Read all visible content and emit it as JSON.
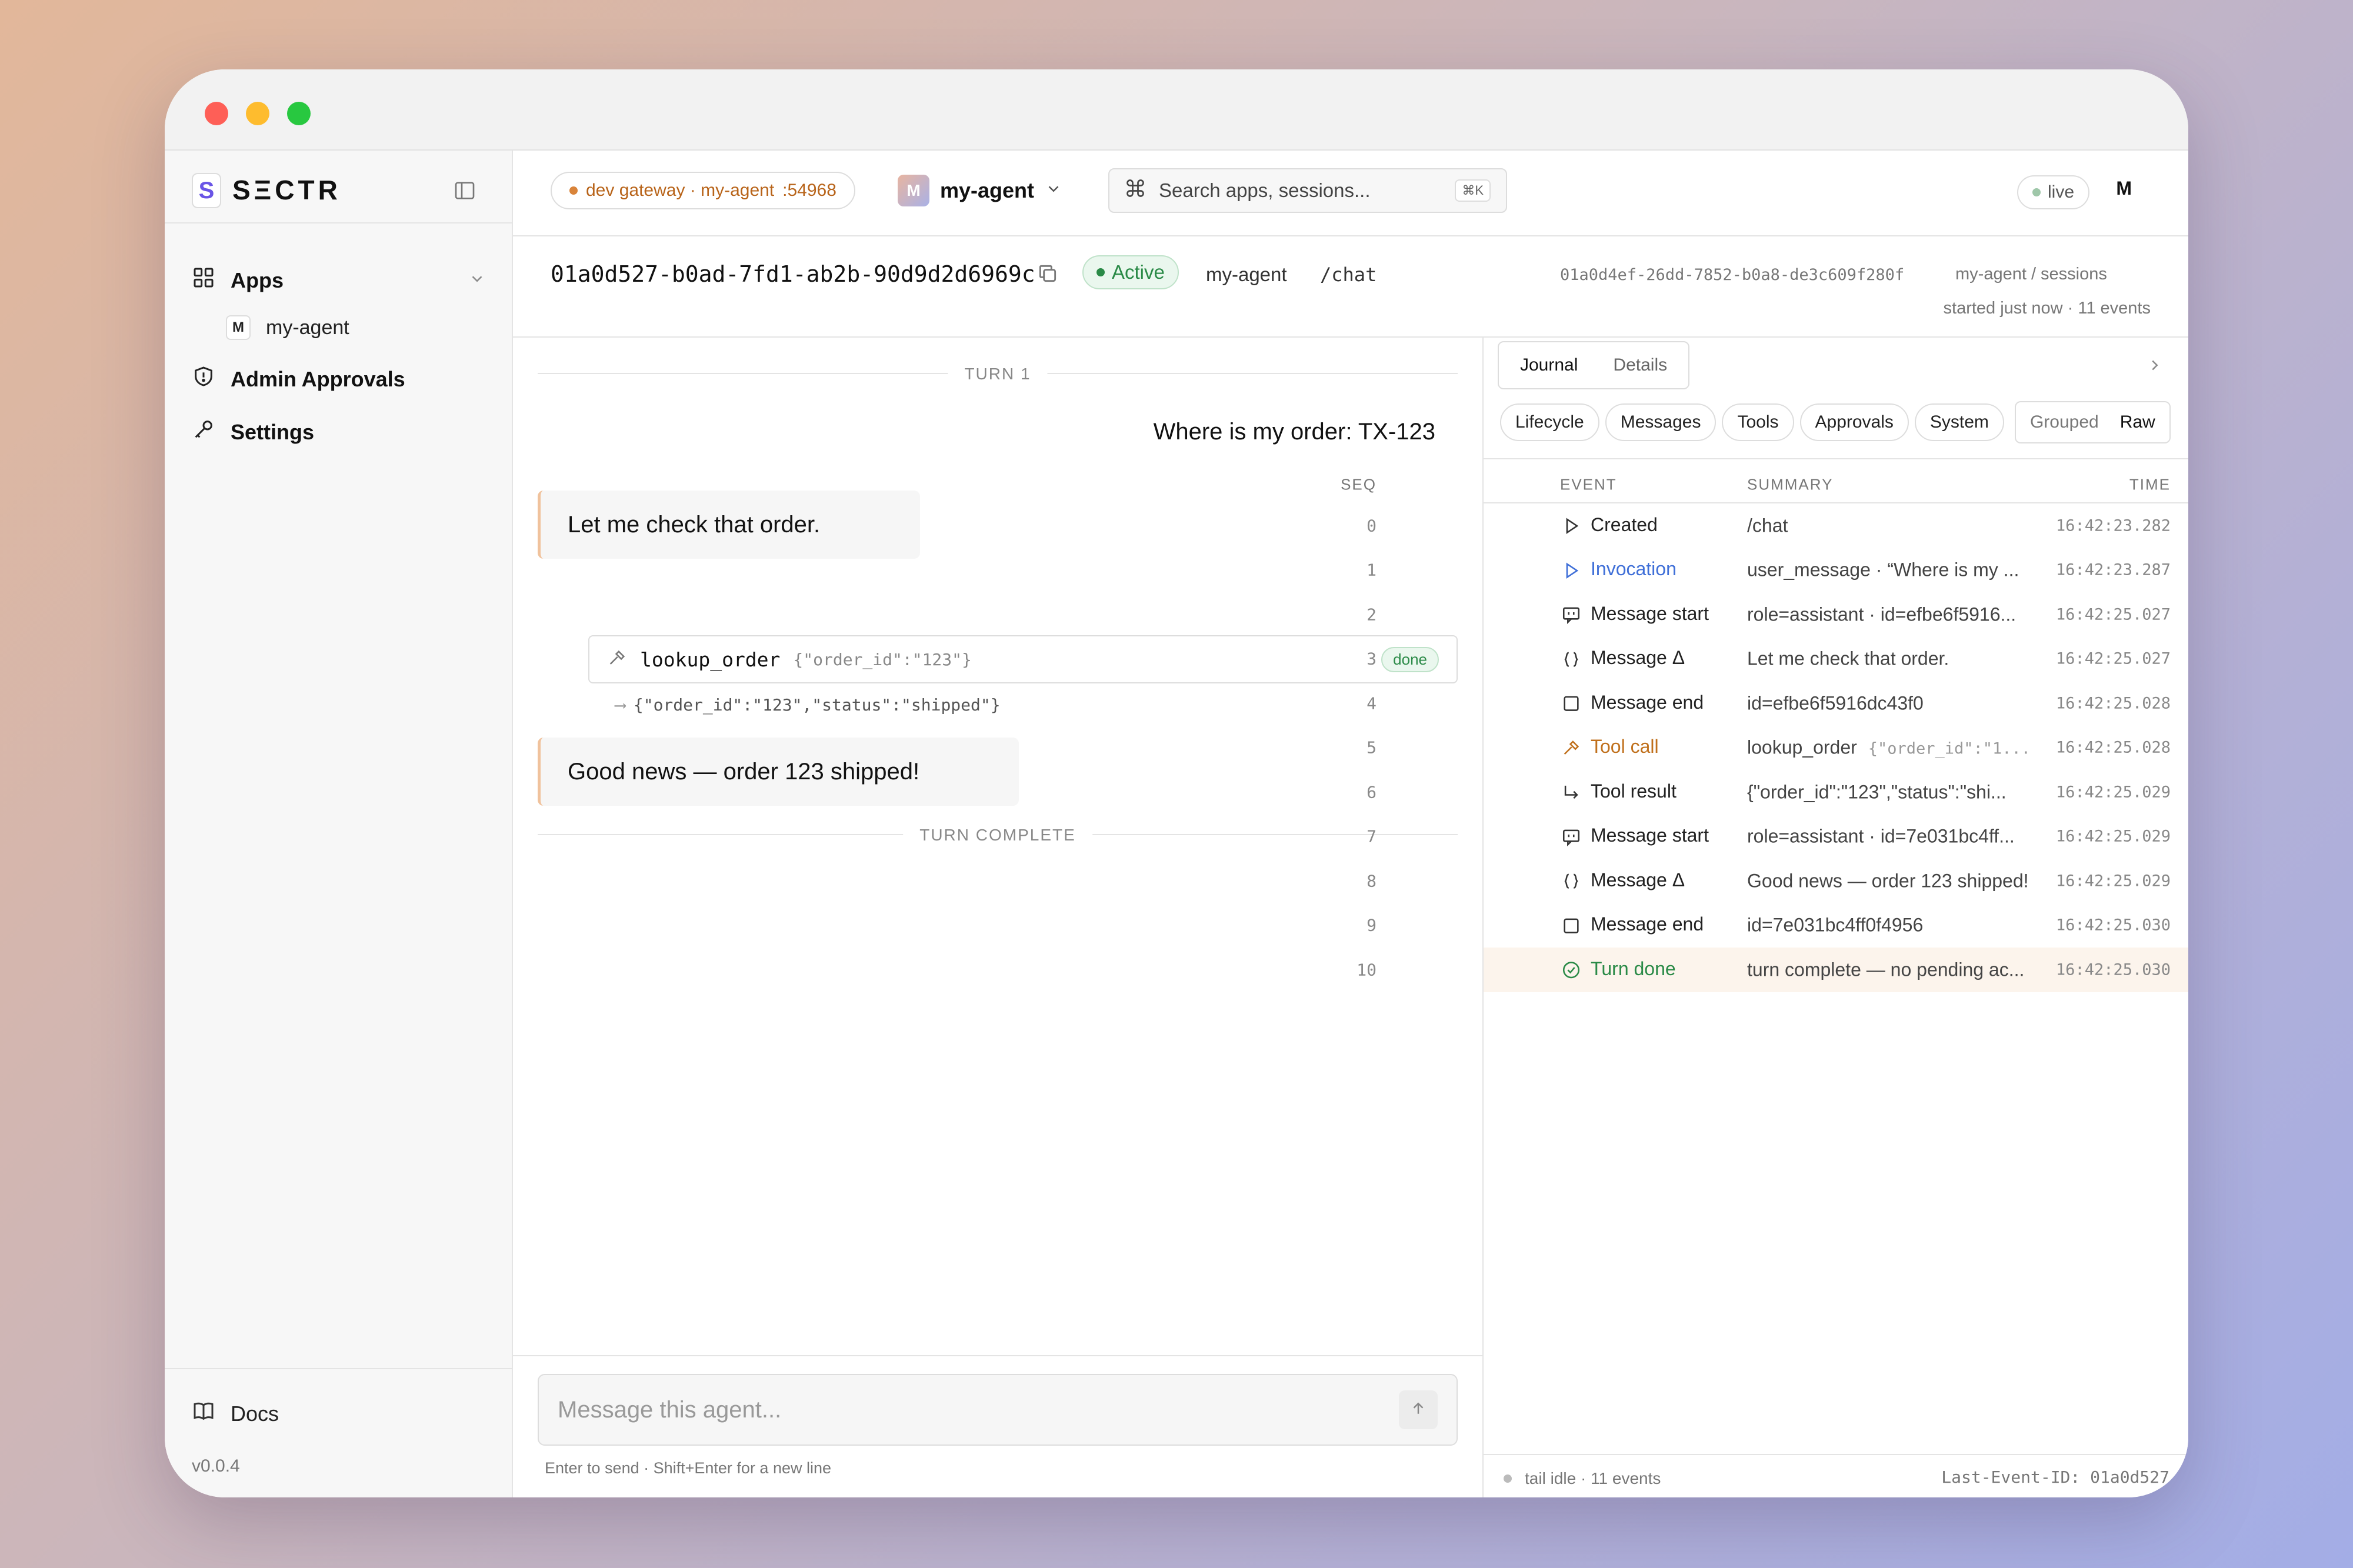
{
  "window": {
    "controls": [
      "close",
      "minimize",
      "zoom"
    ]
  },
  "sidebar": {
    "logo_letter": "S",
    "brand": "SΞCTR",
    "nav": [
      {
        "label": "Apps",
        "icon": "grid-icon"
      },
      {
        "label": "Admin Approvals",
        "icon": "shield-icon"
      },
      {
        "label": "Settings",
        "icon": "key-icon"
      }
    ],
    "apps_children": [
      {
        "badge": "M",
        "label": "my-agent"
      }
    ],
    "docs_label": "Docs",
    "version": "v0.0.4"
  },
  "topbar": {
    "gateway": "dev gateway · my-agent",
    "port": ":54968",
    "agent_badge": "M",
    "agent_name": "my-agent",
    "search_placeholder": "Search apps, sessions...",
    "search_shortcut": "⌘K",
    "live_label": "live",
    "user_initial": "M"
  },
  "session": {
    "id": "01a0d527-b0ad-7fd1-ab2b-90d9d2d6969c",
    "status": "Active",
    "agent": "my-agent",
    "route": "/chat",
    "run_id": "01a0d4ef-26dd-7852-b0a8-de3c609f280f",
    "crumb": "my-agent / sessions",
    "meta": "started just now · 11 events"
  },
  "chat": {
    "turn_label": "TURN 1",
    "user_message": "Where is my order: TX-123",
    "assistant_1": "Let me check that order.",
    "tool": {
      "name": "lookup_order",
      "args": "{\"order_id\":\"123\"}",
      "status": "done",
      "result": "{\"order_id\":\"123\",\"status\":\"shipped\"}"
    },
    "assistant_2": "Good news — order 123 shipped!",
    "complete_label": "TURN COMPLETE",
    "composer_placeholder": "Message this agent...",
    "hint": "Enter to send · Shift+Enter for a new line"
  },
  "journal": {
    "tabs": [
      "Journal",
      "Details"
    ],
    "filters": [
      "Lifecycle",
      "Messages",
      "Tools",
      "Approvals",
      "System"
    ],
    "view_modes": [
      "Grouped",
      "Raw"
    ],
    "columns": [
      "SEQ",
      "EVENT",
      "SUMMARY",
      "TIME"
    ],
    "rows": [
      {
        "seq": "0",
        "event": "Created",
        "icon": "play-outline-icon",
        "summary": "/chat",
        "summary_extra": "",
        "time": "16:42:23.282",
        "color": "#222222"
      },
      {
        "seq": "1",
        "event": "Invocation",
        "icon": "play-outline-icon",
        "summary": "user_message · “Where is my ...",
        "summary_extra": "",
        "time": "16:42:23.287",
        "color": "#3f6fd8"
      },
      {
        "seq": "2",
        "event": "Message start",
        "icon": "chat-bubble-icon",
        "summary": "role=assistant · id=efbe6f5916...",
        "summary_extra": "",
        "time": "16:42:25.027",
        "color": "#222222"
      },
      {
        "seq": "3",
        "event": "Message Δ",
        "icon": "braces-icon",
        "summary": "Let me check that order.",
        "summary_extra": "",
        "time": "16:42:25.027",
        "color": "#222222"
      },
      {
        "seq": "4",
        "event": "Message end",
        "icon": "square-icon",
        "summary": "id=efbe6f5916dc43f0",
        "summary_extra": "",
        "time": "16:42:25.028",
        "color": "#222222"
      },
      {
        "seq": "5",
        "event": "Tool call",
        "icon": "hammer-icon",
        "summary": "lookup_order",
        "summary_extra": "{\"order_id\":\"1...",
        "time": "16:42:25.028",
        "color": "#c0701c"
      },
      {
        "seq": "6",
        "event": "Tool result",
        "icon": "return-arrow-icon",
        "summary": "{\"order_id\":\"123\",\"status\":\"shi...",
        "summary_extra": "",
        "time": "16:42:25.029",
        "color": "#222222"
      },
      {
        "seq": "7",
        "event": "Message start",
        "icon": "chat-bubble-icon",
        "summary": "role=assistant · id=7e031bc4ff...",
        "summary_extra": "",
        "time": "16:42:25.029",
        "color": "#222222"
      },
      {
        "seq": "8",
        "event": "Message Δ",
        "icon": "braces-icon",
        "summary": "Good news — order 123 shipped!",
        "summary_extra": "",
        "time": "16:42:25.029",
        "color": "#222222"
      },
      {
        "seq": "9",
        "event": "Message end",
        "icon": "square-icon",
        "summary": "id=7e031bc4ff0f4956",
        "summary_extra": "",
        "time": "16:42:25.030",
        "color": "#222222"
      },
      {
        "seq": "10",
        "event": "Turn done",
        "icon": "check-circle-icon",
        "summary": "turn complete — no pending ac...",
        "summary_extra": "",
        "time": "16:42:25.030",
        "color": "#2a8a47"
      }
    ],
    "footer_left": "tail idle · 11 events",
    "footer_right": "Last-Event-ID: 01a0d527"
  }
}
